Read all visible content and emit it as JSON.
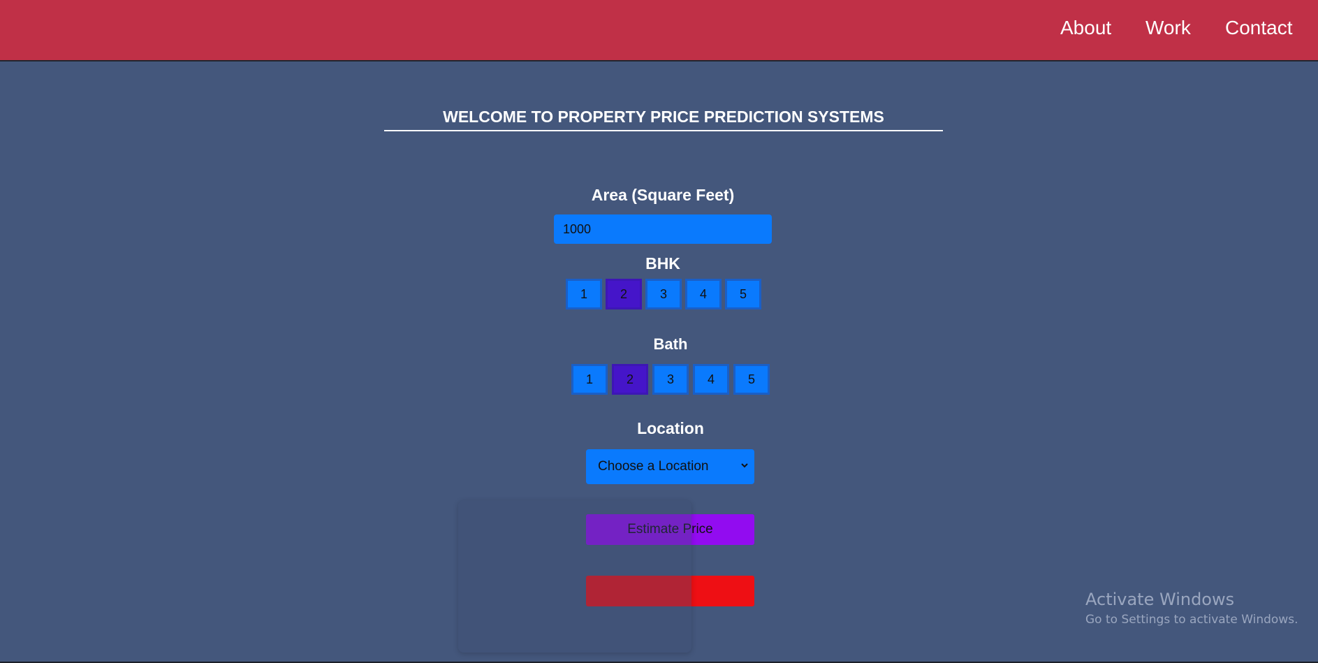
{
  "nav": {
    "links": [
      {
        "label": "About"
      },
      {
        "label": "Work"
      },
      {
        "label": "Contact"
      }
    ]
  },
  "main": {
    "heading": "WELCOME TO PROPERTY PRICE PREDICTION SYSTEMS",
    "area": {
      "label": "Area (Square Feet)",
      "value": "1000"
    },
    "bhk": {
      "label": "BHK",
      "options": [
        "1",
        "2",
        "3",
        "4",
        "5"
      ],
      "selected": "2"
    },
    "bath": {
      "label": "Bath",
      "options": [
        "1",
        "2",
        "3",
        "4",
        "5"
      ],
      "selected": "2"
    },
    "location": {
      "label": "Location",
      "selected_value": "Choose a Location"
    },
    "estimate_button": "Estimate Price"
  },
  "colors": {
    "header": "#c03047",
    "background": "#44577c",
    "control_blue": "#0a7afd",
    "selected_purple": "#4515c9",
    "estimate_purple": "#920cf0",
    "result_red": "#ee0f14"
  },
  "windows_watermark": {
    "title": "Activate Windows",
    "subtitle": "Go to Settings to activate Windows."
  }
}
